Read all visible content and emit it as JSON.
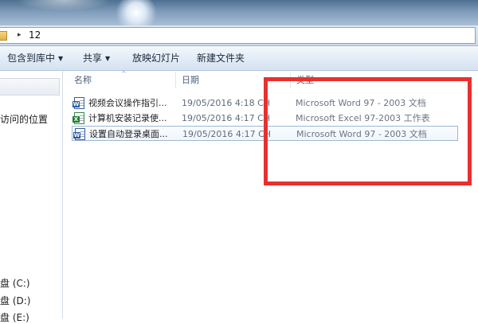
{
  "window": {
    "address": {
      "path_segment": "12",
      "separator": "▸"
    }
  },
  "toolbar": {
    "include_library": "包含到库中",
    "share": "共享",
    "slideshow": "放映幻灯片",
    "new_folder": "新建文件夹",
    "dropdown_arrow": "▼"
  },
  "nav": {
    "recent_places": "访问的位置",
    "drives": [
      "盘 (C:)",
      "盘 (D:)",
      "盘 (E:)"
    ]
  },
  "columns": {
    "name": "名称",
    "date": "日期",
    "type": "类型",
    "sort_indicator": "^"
  },
  "files": [
    {
      "name": "视频会议操作指引...",
      "date": "19/05/2016 4:18 CH",
      "type": "Microsoft Word 97 - 2003 文档",
      "icon": "word-doc-icon",
      "selected": false
    },
    {
      "name": "计算机安装记录使...",
      "date": "19/05/2016 4:17 CH",
      "type": "Microsoft Excel 97-2003 工作表",
      "icon": "excel-sheet-icon",
      "selected": false
    },
    {
      "name": "设置自动登录桌面...",
      "date": "19/05/2016 4:17 CH",
      "type": "Microsoft Word 97 - 2003 文档",
      "icon": "word-doc-icon",
      "selected": true
    }
  ],
  "annotation": {
    "color": "#e8302f",
    "shape": "rectangle",
    "target": "file type column"
  }
}
